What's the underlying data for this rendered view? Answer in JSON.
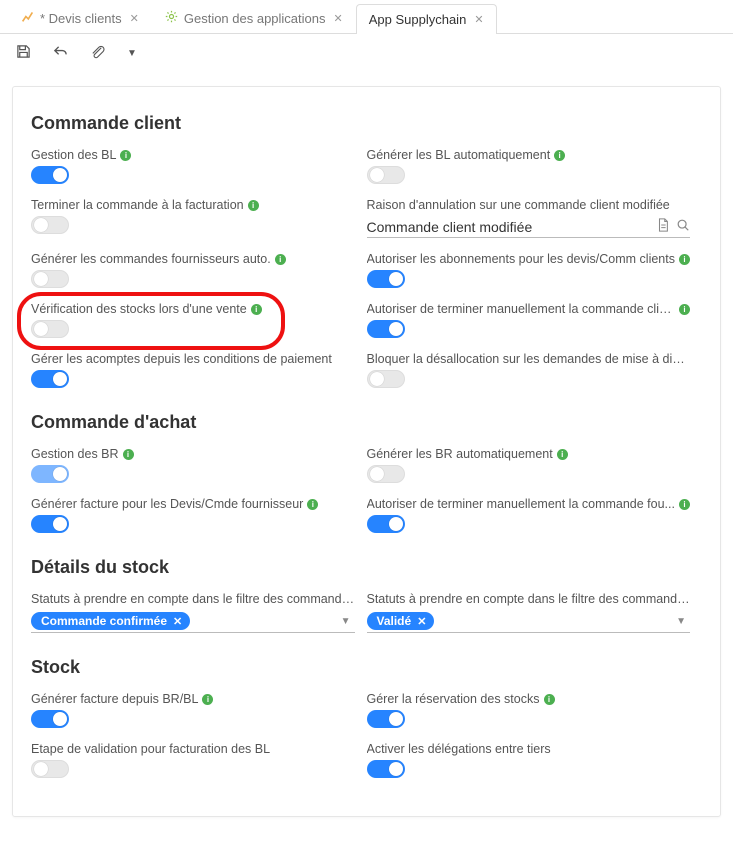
{
  "tabs": [
    {
      "label": "* Devis clients",
      "active": false,
      "icon": "chart"
    },
    {
      "label": "Gestion des applications",
      "active": false,
      "icon": "gear"
    },
    {
      "label": "App Supplychain",
      "active": true,
      "icon": ""
    }
  ],
  "sections": {
    "commande_client": {
      "title": "Commande client",
      "fields": {
        "gestion_bl": {
          "label": "Gestion des BL",
          "info": true,
          "on": true
        },
        "gen_bl_auto": {
          "label": "Générer les BL automatiquement",
          "info": true,
          "on": false
        },
        "terminer_fact": {
          "label": "Terminer la commande à la facturation",
          "info": true,
          "on": false
        },
        "raison_annul": {
          "label": "Raison d'annulation sur une commande client modifiée",
          "value": "Commande client modifiée"
        },
        "gen_cmd_fourn": {
          "label": "Générer les commandes fournisseurs auto.",
          "info": true,
          "on": false
        },
        "autoriser_abo": {
          "label": "Autoriser les abonnements pour les devis/Comm clients",
          "info": true,
          "on": true
        },
        "verif_stocks": {
          "label": "Vérification des stocks lors d'une vente",
          "info": true,
          "on": false
        },
        "autoriser_term": {
          "label": "Autoriser de terminer manuellement la commande clie...",
          "info": true,
          "on": true
        },
        "gerer_acomptes": {
          "label": "Gérer les acomptes depuis les conditions de paiement",
          "info": false,
          "on": true
        },
        "bloquer_desalloc": {
          "label": "Bloquer la désallocation sur les demandes de mise à dispo.",
          "info": false,
          "on": false
        }
      }
    },
    "commande_achat": {
      "title": "Commande d'achat",
      "fields": {
        "gestion_br": {
          "label": "Gestion des BR",
          "info": true,
          "on": true
        },
        "gen_br_auto": {
          "label": "Générer les BR automatiquement",
          "info": true,
          "on": false
        },
        "gen_fact_devis": {
          "label": "Générer facture pour les Devis/Cmde fournisseur",
          "info": true,
          "on": true
        },
        "autoriser_term_f": {
          "label": "Autoriser de terminer manuellement la commande fou...",
          "info": true,
          "on": true
        }
      }
    },
    "details_stock": {
      "title": "Détails du stock",
      "fields": {
        "statuts_left": {
          "label": "Statuts à prendre en compte dans le filtre des commande...",
          "chip": "Commande confirmée"
        },
        "statuts_right": {
          "label": "Statuts à prendre en compte dans le filtre des commande...",
          "chip": "Validé"
        }
      }
    },
    "stock": {
      "title": "Stock",
      "fields": {
        "gen_fact_brbl": {
          "label": "Générer facture depuis BR/BL",
          "info": true,
          "on": true
        },
        "gerer_reserv": {
          "label": "Gérer la réservation des stocks",
          "info": true,
          "on": true
        },
        "etape_valid": {
          "label": "Etape de validation pour facturation des BL",
          "info": false,
          "on": false
        },
        "activer_deleg": {
          "label": "Activer les délégations entre tiers",
          "info": false,
          "on": true
        }
      }
    }
  }
}
